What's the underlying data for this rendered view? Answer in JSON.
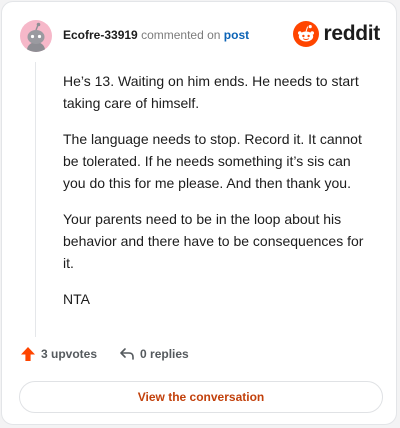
{
  "comment": {
    "username": "Ecofre-33919",
    "action_text": "commented on",
    "post_link": "post",
    "paragraphs": [
      "He’s 13. Waiting on him ends. He needs to start taking care of himself.",
      "The language needs to stop. Record it. It cannot be tolerated. If he needs something it’s sis can you do this for me please. And then thank you.",
      "Your parents need to be in the loop about his behavior and there have to be consequences for it.",
      "NTA"
    ]
  },
  "brand": {
    "name": "reddit",
    "accent": "#ff4500"
  },
  "actions": {
    "upvotes": "3 upvotes",
    "replies": "0 replies",
    "upvote_icon": "arrow-up-icon",
    "reply_icon": "reply-arrow-icon"
  },
  "cta": {
    "label": "View the conversation",
    "color": "#c2410c"
  },
  "colors": {
    "avatar_bg": "#f6b8c9",
    "link": "#0b63b6",
    "upvote": "#ff4500"
  }
}
